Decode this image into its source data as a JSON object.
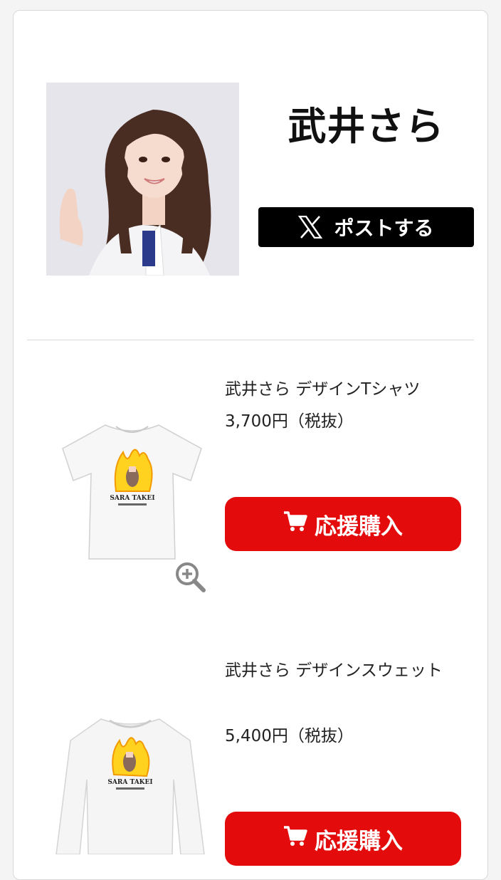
{
  "profile": {
    "name": "武井さら",
    "post_button_label": "ポストする"
  },
  "products": [
    {
      "title": "武井さら デザインTシャツ",
      "price": "3,700円（税抜）",
      "buy_label": "応援購入",
      "print_name": "SARA TAKEI"
    },
    {
      "title": "武井さら デザインスウェット",
      "price": "5,400円（税抜）",
      "buy_label": "応援購入",
      "print_name": "SARA TAKEI"
    }
  ],
  "colors": {
    "accent_red": "#e30b0b",
    "post_button_bg": "#000000"
  }
}
